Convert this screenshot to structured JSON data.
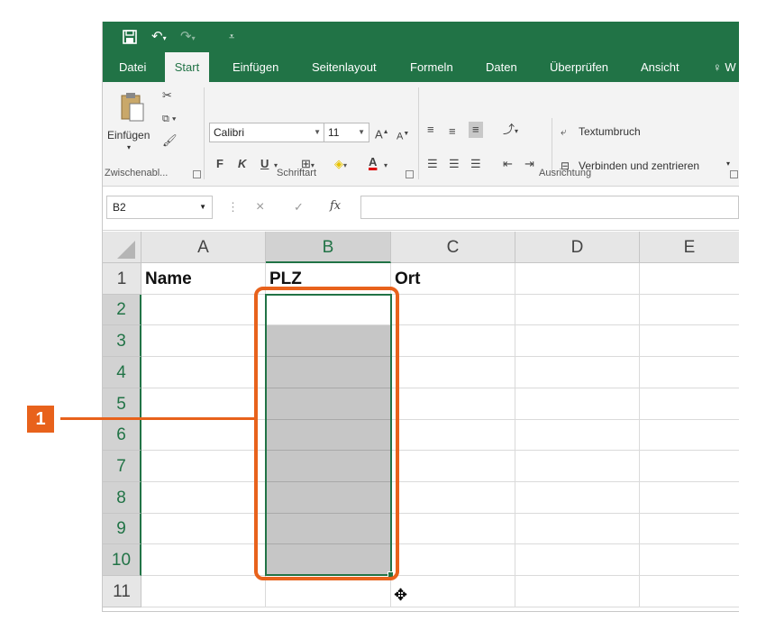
{
  "qat": {
    "save_icon": "save-icon",
    "undo_icon": "undo-icon",
    "redo_icon": "redo-icon",
    "customize_icon": "customize-qat-icon"
  },
  "tabs": [
    "Datei",
    "Start",
    "Einfügen",
    "Seitenlayout",
    "Formeln",
    "Daten",
    "Überprüfen",
    "Ansicht",
    "W"
  ],
  "active_tab": "Start",
  "ribbon": {
    "clipboard": {
      "paste_label": "Einfügen",
      "group_label": "Zwischenabl..."
    },
    "font": {
      "font_name": "Calibri",
      "font_size": "11",
      "bold": "F",
      "italic": "K",
      "underline": "U",
      "group_label": "Schriftart"
    },
    "alignment": {
      "wrap_text": "Textumbruch",
      "merge_center": "Verbinden und zentrieren",
      "group_label": "Ausrichtung"
    }
  },
  "formula_bar": {
    "name_box": "B2",
    "fx": "fx",
    "cancel": "×",
    "confirm": "✓",
    "value": ""
  },
  "grid": {
    "columns": [
      "A",
      "B",
      "C",
      "D",
      "E"
    ],
    "selected_column": "B",
    "rows": [
      "1",
      "2",
      "3",
      "4",
      "5",
      "6",
      "7",
      "8",
      "9",
      "10",
      "11"
    ],
    "header_cells": {
      "A1": "Name",
      "B1": "PLZ",
      "C1": "Ort"
    },
    "selection": "B2:B10",
    "active_cell": "B2"
  },
  "annotation": {
    "badge": "1"
  },
  "colors": {
    "excel_green": "#217346",
    "annotation_orange": "#e8621c",
    "selection_fill": "#c6c6c6"
  }
}
